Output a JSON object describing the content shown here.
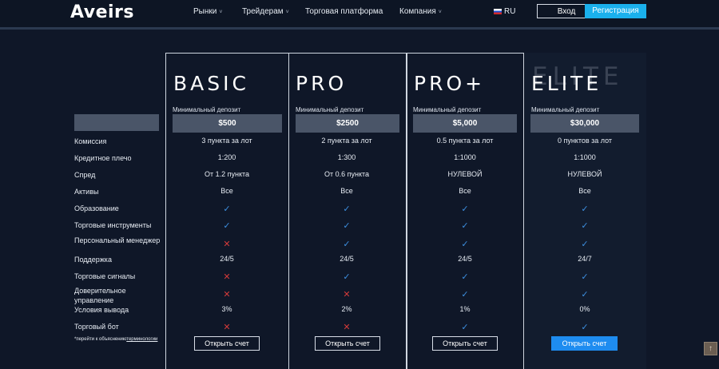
{
  "header": {
    "logo": "Aveirs",
    "nav": [
      {
        "label": "Рынки",
        "caret": "˅"
      },
      {
        "label": "Трейдерам",
        "caret": "˅"
      },
      {
        "label": "Торговая платформа",
        "caret": ""
      },
      {
        "label": "Компания",
        "caret": "˅"
      }
    ],
    "lang": "RU",
    "login": "Вход",
    "register": "Регистрация"
  },
  "row_labels": [
    "Комиссия",
    "Кредитное плечо",
    "Спред",
    "Активы",
    "Образование",
    "Торговые инструменты",
    "Персональный менеджер",
    "Поддержка",
    "Торговые сигналы",
    "Доверительное управление",
    "Условия вывода",
    "Торговый бот"
  ],
  "footnote": {
    "text": "*перейти к объяснению",
    "link": "терминологии"
  },
  "min_deposit_label": "Минимальный депозит",
  "open_account": "Открыть счет",
  "check": "✓",
  "cross": "✕",
  "plans": [
    {
      "name": "BASIC",
      "deposit": "$500",
      "values": [
        "3 пункта за лот",
        "1:200",
        "От 1.2 пункта",
        "Все",
        "✓",
        "✓",
        "✕",
        "24/5",
        "✕",
        "✕",
        "3%",
        "✕"
      ]
    },
    {
      "name": "PRO",
      "deposit": "$2500",
      "values": [
        "2 пункта за лот",
        "1:300",
        "От 0.6 пункта",
        "Все",
        "✓",
        "✓",
        "✓",
        "24/5",
        "✓",
        "✕",
        "2%",
        "✕"
      ]
    },
    {
      "name": "PRO+",
      "deposit": "$5,000",
      "values": [
        "0.5 пункта за лот",
        "1:1000",
        "НУЛЕВОЙ",
        "Все",
        "✓",
        "✓",
        "✓",
        "24/5",
        "✓",
        "✓",
        "1%",
        "✓"
      ]
    },
    {
      "name": "ELITE",
      "deposit": "$30,000",
      "values": [
        "0 пунктов за лот",
        "1:1000",
        "НУЛЕВОЙ",
        "Все",
        "✓",
        "✓",
        "✓",
        "24/7",
        "✓",
        "✓",
        "0%",
        "✓"
      ]
    }
  ],
  "scroll_top_icon": "arrow-up-icon",
  "colors": {
    "accent": "#1ab0ec",
    "check": "#3d8fe0",
    "cross": "#d43a3a",
    "background": "#0f1728"
  }
}
